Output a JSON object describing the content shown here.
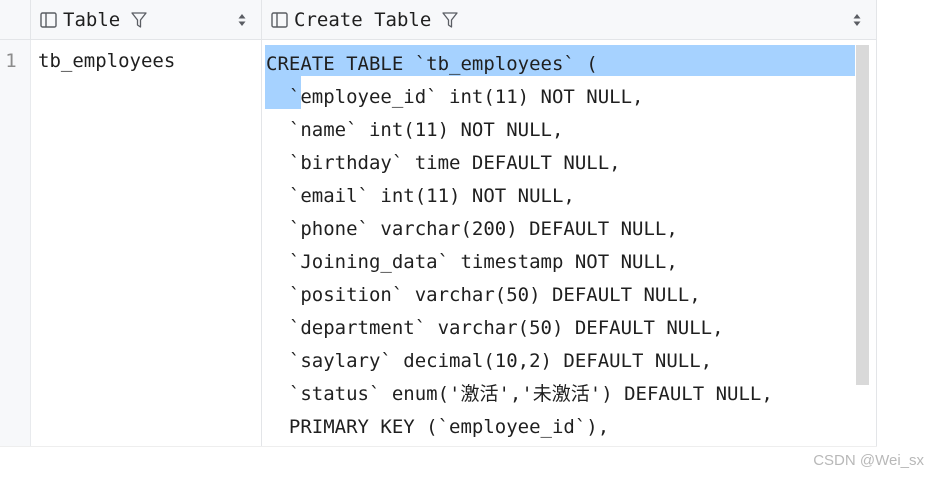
{
  "columns": [
    {
      "label": "Table",
      "icon": "table-icon",
      "filter_icon": "filter-icon",
      "sort_icon": "sort-icon"
    },
    {
      "label": "Create Table",
      "icon": "table-icon",
      "filter_icon": "filter-icon",
      "sort_icon": "sort-icon"
    }
  ],
  "rows": [
    {
      "number": "1",
      "table": "tb_employees",
      "create_table": "CREATE TABLE `tb_employees` (\n  `employee_id` int(11) NOT NULL,\n  `name` int(11) NOT NULL,\n  `birthday` time DEFAULT NULL,\n  `email` int(11) NOT NULL,\n  `phone` varchar(200) DEFAULT NULL,\n  `Joining_data` timestamp NOT NULL,\n  `position` varchar(50) DEFAULT NULL,\n  `department` varchar(50) DEFAULT NULL,\n  `saylary` decimal(10,2) DEFAULT NULL,\n  `status` enum('激活','未激活') DEFAULT NULL,\n  PRIMARY KEY (`employee_id`),"
    }
  ],
  "watermark": "CSDN @Wei_sx",
  "colors": {
    "header_bg": "#f7f8fa",
    "selection": "#a6d2ff",
    "border": "#e3e5e8",
    "scrollbar": "#d9d9d9"
  }
}
